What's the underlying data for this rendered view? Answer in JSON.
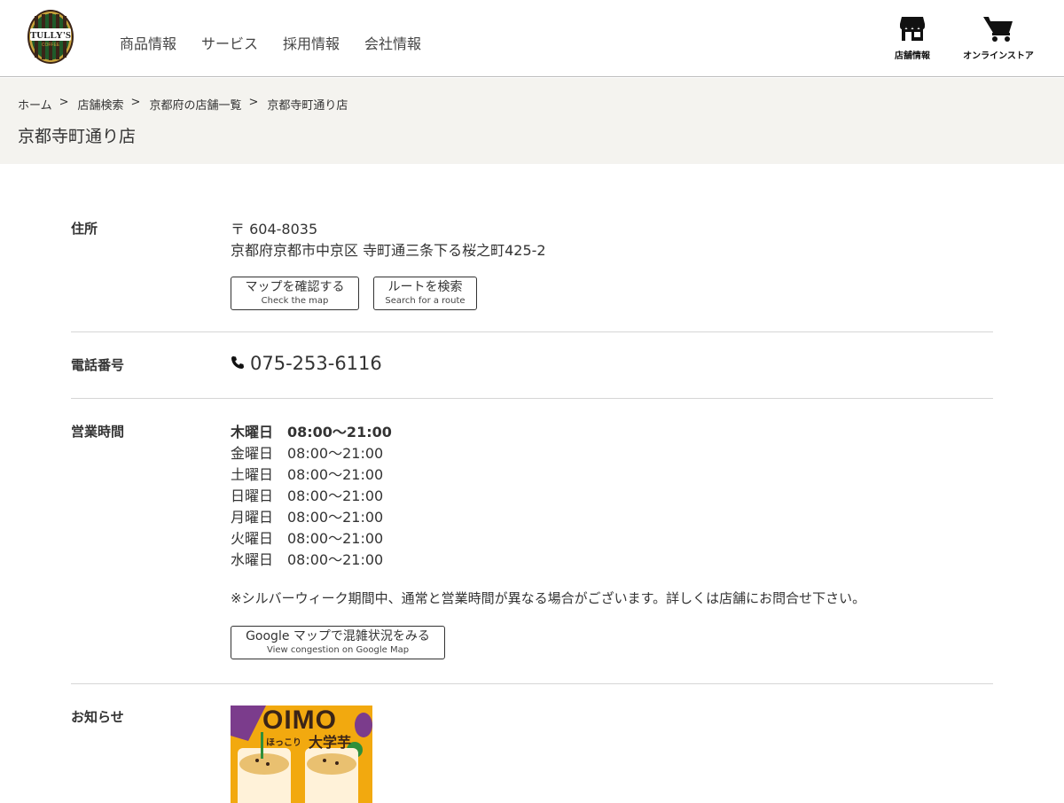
{
  "header": {
    "nav": [
      "商品情報",
      "サービス",
      "採用情報",
      "会社情報"
    ],
    "store_info_label": "店舗情報",
    "online_store_label": "オンラインストア",
    "colors": {
      "logo_ring": "#c8a23a",
      "logo_green": "#1f5a2a",
      "logo_dark": "#3a2418"
    }
  },
  "breadcrumb": [
    "ホーム",
    "店舗検索",
    "京都府の店舗一覧",
    "京都寺町通り店"
  ],
  "breadcrumb_sep": ">",
  "page_title": "京都寺町通り店",
  "address": {
    "label": "住所",
    "postal": "〒 604-8035",
    "line": "京都府京都市中京区 寺町通三条下る桜之町425-2",
    "map_button": {
      "main": "マップを確認する",
      "sub": "Check the map"
    },
    "route_button": {
      "main": "ルートを検索",
      "sub": "Search for a route"
    }
  },
  "phone": {
    "label": "電話番号",
    "number": "075-253-6116",
    "icon": "phone-icon"
  },
  "hours": {
    "label": "営業時間",
    "rows": [
      {
        "day": "木曜日",
        "time": "08:00〜21:00",
        "today": true
      },
      {
        "day": "金曜日",
        "time": "08:00〜21:00"
      },
      {
        "day": "土曜日",
        "time": "08:00〜21:00"
      },
      {
        "day": "日曜日",
        "time": "08:00〜21:00"
      },
      {
        "day": "月曜日",
        "time": "08:00〜21:00"
      },
      {
        "day": "火曜日",
        "time": "08:00〜21:00"
      },
      {
        "day": "水曜日",
        "time": "08:00〜21:00"
      }
    ],
    "note": "※シルバーウィーク期間中、通常と営業時間が異なる場合がございます。詳しくは店舗にお問合せ下さい。",
    "congestion_button": {
      "main": "Google マップで混雑状況をみる",
      "sub": "View congestion on Google Map"
    }
  },
  "notice": {
    "label": "お知らせ",
    "promo_title": "OIMO",
    "promo_subtitle": "ほっこり",
    "promo_name": "大学芋"
  }
}
